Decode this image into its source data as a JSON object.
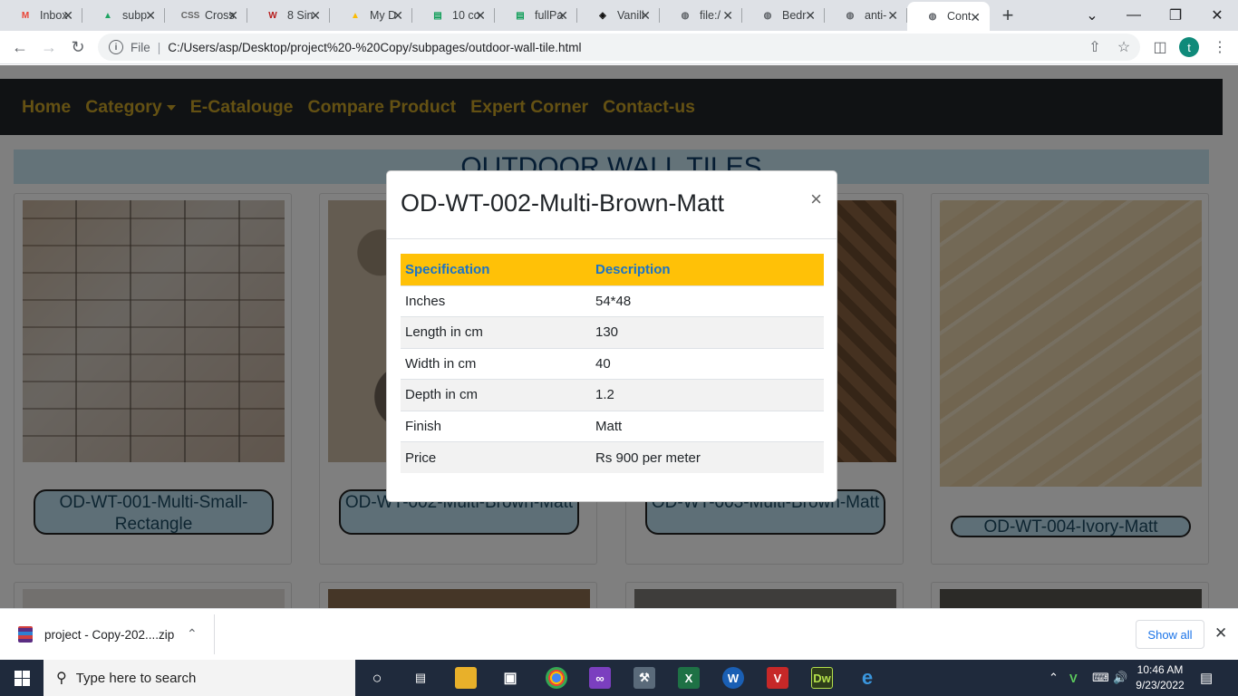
{
  "browser": {
    "tabs": [
      {
        "title": "Inbox",
        "icon": "gmail-icon",
        "icon_text": "M",
        "icon_color": "#ea4335"
      },
      {
        "title": "subp",
        "icon": "drive-icon",
        "icon_text": "▲",
        "icon_color": "#1fa463"
      },
      {
        "title": "Cross",
        "icon": "css3-icon",
        "icon_text": "CSS",
        "icon_color": "#666666"
      },
      {
        "title": "8 Sin",
        "icon": "w-logo-icon",
        "icon_text": "W",
        "icon_color": "#b71c1c"
      },
      {
        "title": "My D",
        "icon": "drive-icon",
        "icon_text": "▲",
        "icon_color": "#fbbc04"
      },
      {
        "title": "10 co",
        "icon": "sheet-icon",
        "icon_text": "▤",
        "icon_color": "#0f9d58"
      },
      {
        "title": "fullPa",
        "icon": "sheet-icon",
        "icon_text": "▤",
        "icon_color": "#0f9d58"
      },
      {
        "title": "Vanill",
        "icon": "codepen-icon",
        "icon_text": "◈",
        "icon_color": "#111111"
      },
      {
        "title": "file:/",
        "icon": "globe-icon",
        "icon_text": "◍",
        "icon_color": "#5f6368"
      },
      {
        "title": "Bedr",
        "icon": "globe-icon",
        "icon_text": "◍",
        "icon_color": "#5f6368"
      },
      {
        "title": "anti-",
        "icon": "globe-icon",
        "icon_text": "◍",
        "icon_color": "#5f6368"
      },
      {
        "title": "Cont",
        "icon": "globe-icon",
        "icon_text": "◍",
        "icon_color": "#5f6368",
        "active": true
      }
    ],
    "url_scheme_label": "File",
    "url": "C:/Users/asp/Desktop/project%20-%20Copy/subpages/outdoor-wall-tile.html",
    "avatar_letter": "t"
  },
  "site": {
    "nav": [
      {
        "label": "Home"
      },
      {
        "label": "Category",
        "dropdown": true
      },
      {
        "label": "E-Catalouge"
      },
      {
        "label": "Compare Product"
      },
      {
        "label": "Expert Corner"
      },
      {
        "label": "Contact-us"
      }
    ],
    "heading": "OUTDOOR WALL TILES",
    "products": [
      {
        "name": "OD-WT-001-Multi-Small-Rectangle"
      },
      {
        "name": "OD-WT-002-Multi-Brown-Matt"
      },
      {
        "name": "OD-WT-003-Multi-Brown-Matt"
      },
      {
        "name": "OD-WT-004-Ivory-Matt"
      }
    ]
  },
  "modal": {
    "title": "OD-WT-002-Multi-Brown-Matt",
    "close_label": "×",
    "headers": [
      "Specification",
      "Description"
    ],
    "rows": [
      [
        "Inches",
        "54*48"
      ],
      [
        "Length in cm",
        "130"
      ],
      [
        "Width in cm",
        "40"
      ],
      [
        "Depth in cm",
        "1.2"
      ],
      [
        "Finish",
        "Matt"
      ],
      [
        "Price",
        "Rs 900 per meter"
      ]
    ]
  },
  "downloads": {
    "file": "project - Copy-202....zip",
    "show_all": "Show all"
  },
  "taskbar": {
    "search_placeholder": "Type here to search",
    "time": "10:46 AM",
    "date": "9/23/2022"
  },
  "colors": {
    "navbar_bg": "#212529",
    "nav_link": "#c9a227",
    "table_header_bg": "#ffc107",
    "table_header_text": "#1a73c8",
    "caption_bg": "#bcdeee"
  }
}
